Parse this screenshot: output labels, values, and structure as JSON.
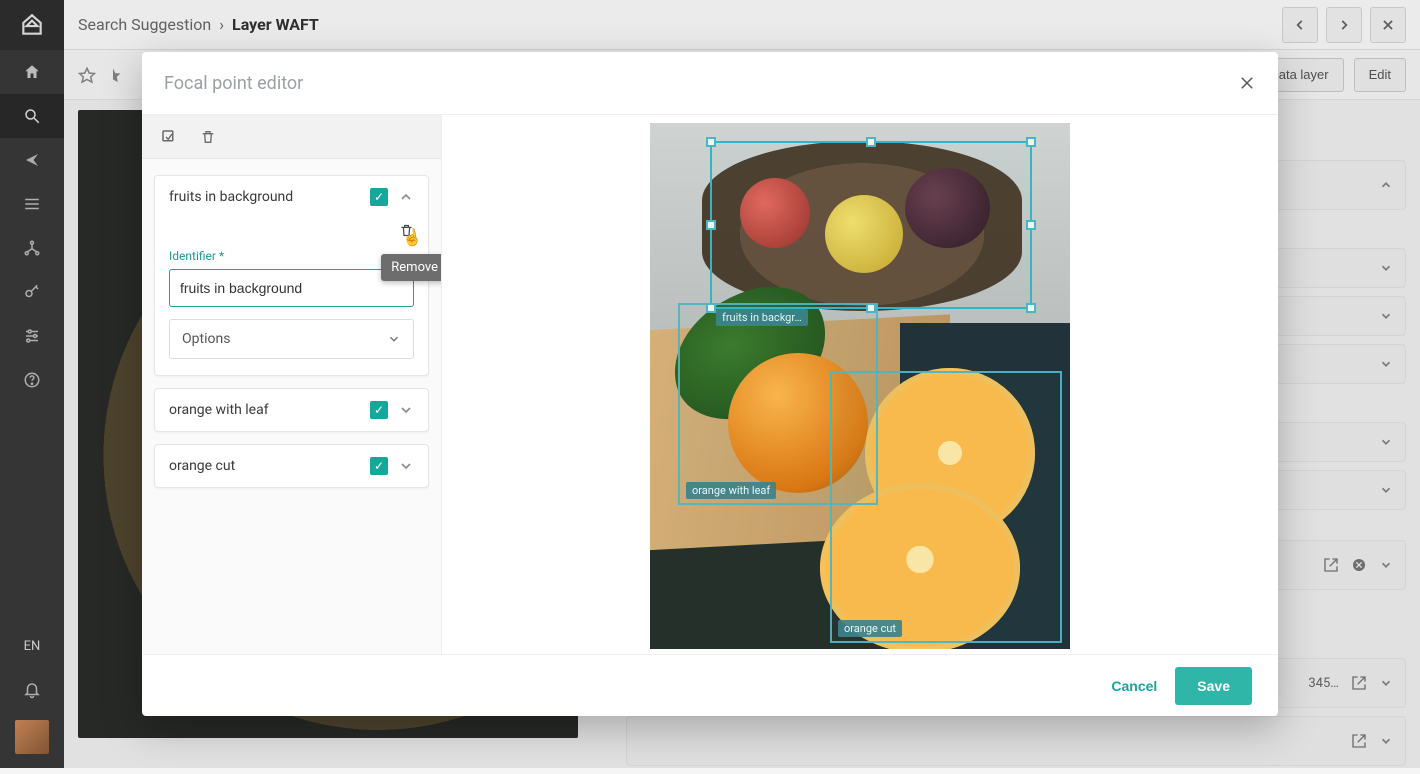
{
  "breadcrumb": {
    "parent": "Search Suggestion",
    "sep": "›",
    "current": "Layer WAFT"
  },
  "leftnav": {
    "lang": "EN"
  },
  "subbar": {
    "data_layer": "Data layer",
    "edit": "Edit"
  },
  "bg": {
    "ellipsis": "345…"
  },
  "modal": {
    "title": "Focal point editor",
    "tooltip_remove": "Remove",
    "identifier_label": "Identifier",
    "asterisk": "*",
    "options_label": "Options",
    "focal_points": [
      {
        "name": "fruits in background",
        "checked": true,
        "expanded": true,
        "short_label": "fruits in backgr…",
        "identifier_value": "fruits in background"
      },
      {
        "name": "orange with leaf",
        "checked": true,
        "expanded": false,
        "short_label": "orange with leaf"
      },
      {
        "name": "orange cut",
        "checked": true,
        "expanded": false,
        "short_label": "orange cut"
      }
    ],
    "footer": {
      "cancel": "Cancel",
      "save": "Save"
    }
  }
}
